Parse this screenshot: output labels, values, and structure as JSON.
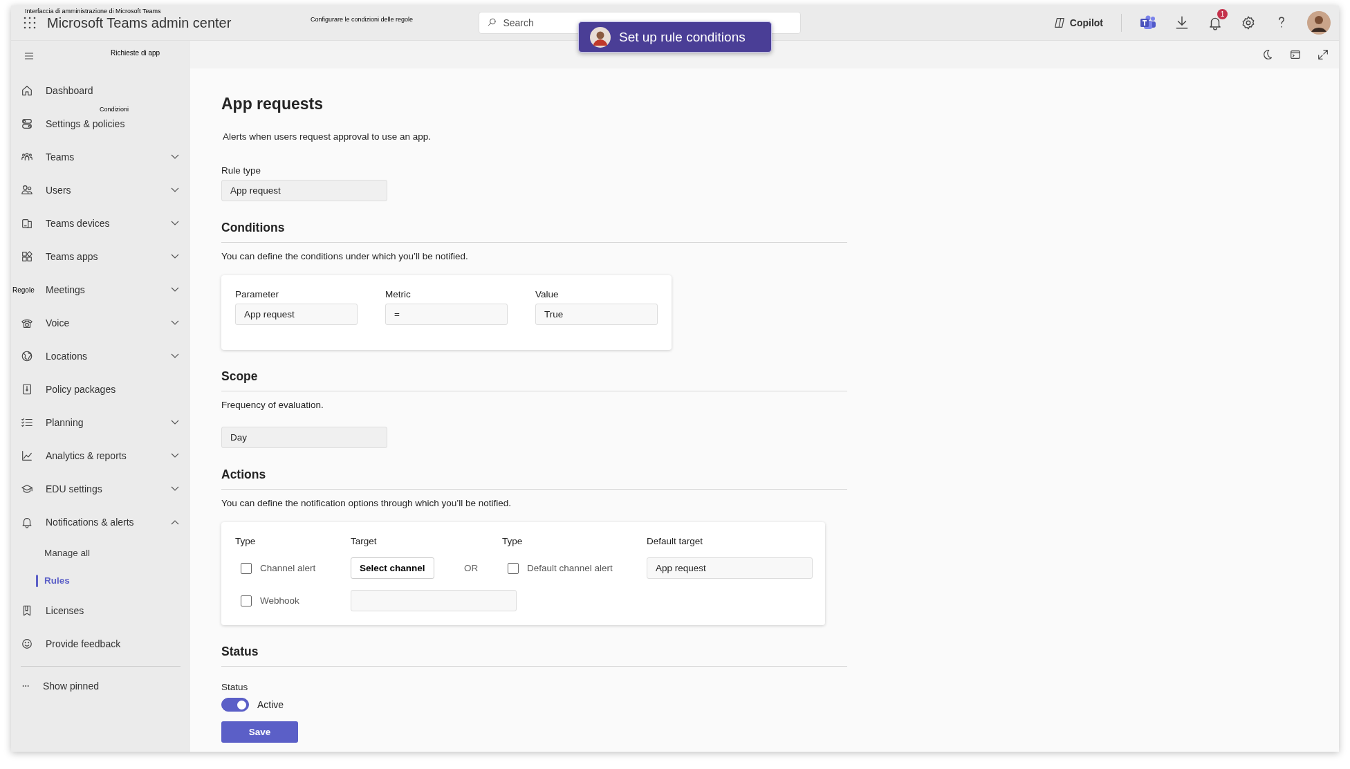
{
  "top_bar": {
    "annotation": "Interfaccia di amministrazione di Microsoft Teams",
    "title": "Microsoft Teams admin center",
    "center_annotation": "Configurare le condizioni delle regole",
    "search": {
      "placeholder": "Search"
    },
    "copilot": "Copilot",
    "notification_count": "1"
  },
  "tooltip": {
    "text": "Set up rule conditions"
  },
  "sidebar": {
    "annotation": "Richieste di app",
    "items": [
      {
        "label": "Dashboard",
        "kind": "link"
      },
      {
        "label": "Settings & policies",
        "kind": "link",
        "annotation": "Condizioni"
      },
      {
        "label": "Teams",
        "kind": "group",
        "expanded": false
      },
      {
        "label": "Users",
        "kind": "group",
        "expanded": false
      },
      {
        "label": "Teams devices",
        "kind": "group",
        "expanded": false
      },
      {
        "label": "Teams apps",
        "kind": "group",
        "expanded": false
      },
      {
        "label": "Meetings",
        "kind": "group",
        "expanded": false,
        "annotation": "Regole"
      },
      {
        "label": "Voice",
        "kind": "group",
        "expanded": false
      },
      {
        "label": "Locations",
        "kind": "group",
        "expanded": false
      },
      {
        "label": "Policy packages",
        "kind": "link"
      },
      {
        "label": "Planning",
        "kind": "group",
        "expanded": false
      },
      {
        "label": "Analytics & reports",
        "kind": "group",
        "expanded": false
      },
      {
        "label": "EDU settings",
        "kind": "group",
        "expanded": false
      },
      {
        "label": "Notifications & alerts",
        "kind": "group",
        "expanded": true,
        "children": [
          {
            "label": "Manage all",
            "selected": false
          },
          {
            "label": "Rules",
            "selected": true
          }
        ]
      },
      {
        "label": "Licenses",
        "kind": "link"
      },
      {
        "label": "Provide feedback",
        "kind": "link"
      }
    ],
    "pinned": "Show pinned"
  },
  "page": {
    "title": "App requests",
    "description": "Alerts when users request approval to use an app.",
    "rule_type": {
      "label": "Rule type",
      "value": "App request"
    }
  },
  "conditions": {
    "heading": "Conditions",
    "description": "You can define the conditions under which you’ll be notified.",
    "fields": [
      {
        "label": "Parameter",
        "value": "App request"
      },
      {
        "label": "Metric",
        "value": "="
      },
      {
        "label": "Value",
        "value": "True"
      }
    ]
  },
  "scope": {
    "heading": "Scope",
    "description": "Frequency of evaluation.",
    "value": "Day"
  },
  "actions": {
    "heading": "Actions",
    "description": "You can define the notification options through which you’ll be notified.",
    "headers": [
      "Type",
      "Target",
      "Type",
      "Default target"
    ],
    "rows": [
      {
        "label": "Channel alert",
        "checked": false,
        "kind": "button",
        "target": "Select channel"
      },
      {
        "label": "Webhook",
        "checked": false,
        "kind": "field"
      }
    ],
    "separator": "OR",
    "default_alert": {
      "label": "Default channel alert",
      "checked": false
    },
    "default_target": "App request"
  },
  "status": {
    "heading": "Status",
    "label": "Status",
    "toggle": {
      "on": true,
      "label": "Active"
    }
  },
  "save": "Save"
}
